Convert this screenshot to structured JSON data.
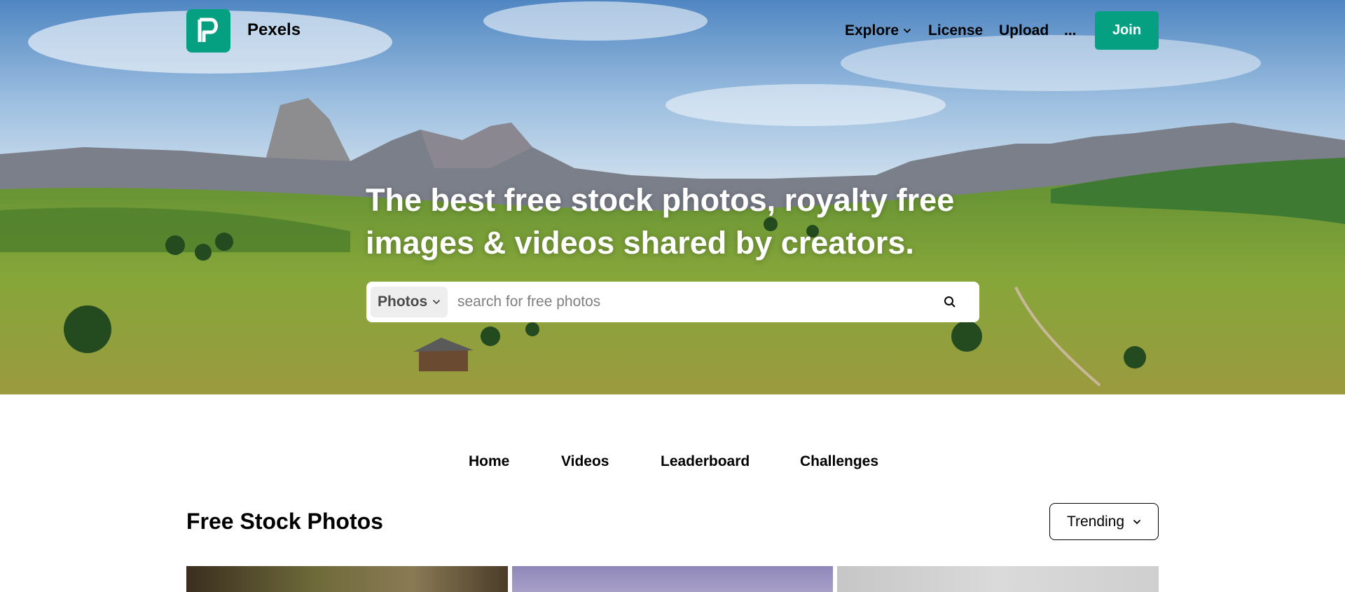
{
  "nav": {
    "brand": "Pexels",
    "explore": "Explore",
    "license": "License",
    "upload": "Upload",
    "more": "...",
    "join": "Join"
  },
  "hero": {
    "headline_line1": "The best free stock photos, royalty free",
    "headline_line2": "images & videos shared by creators.",
    "search": {
      "type": "Photos",
      "placeholder": "search for free photos"
    }
  },
  "tabs": [
    "Home",
    "Videos",
    "Leaderboard",
    "Challenges"
  ],
  "section": {
    "title": "Free Stock Photos",
    "sort": "Trending"
  },
  "icons": {
    "logo": "pexels-logo-icon",
    "explore_chevron": "chevron-down-icon",
    "search": "search-icon",
    "type_chevron": "chevron-down-icon",
    "sort_chevron": "chevron-down-icon"
  },
  "colors": {
    "brand": "#05a081",
    "text": "#000000"
  }
}
